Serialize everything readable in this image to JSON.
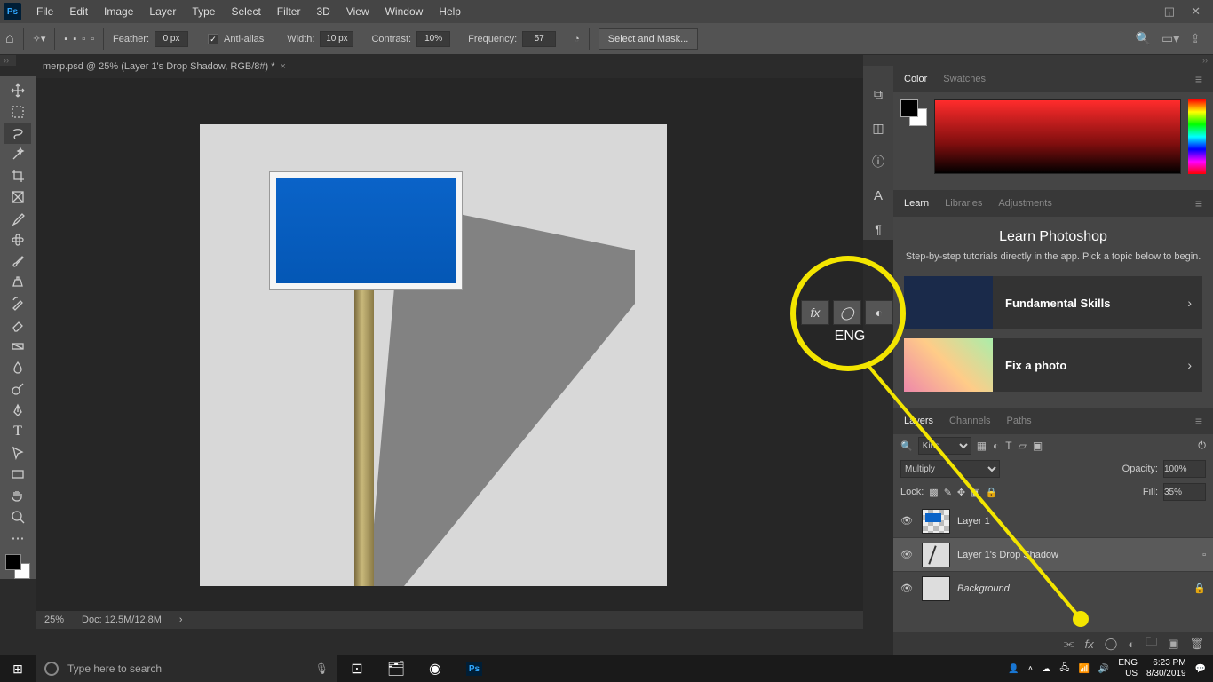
{
  "menubar": {
    "items": [
      "File",
      "Edit",
      "Image",
      "Layer",
      "Type",
      "Select",
      "Filter",
      "3D",
      "View",
      "Window",
      "Help"
    ]
  },
  "optbar": {
    "feather_label": "Feather:",
    "feather_val": "0 px",
    "aa_label": "Anti-alias",
    "width_label": "Width:",
    "width_val": "10 px",
    "contrast_label": "Contrast:",
    "contrast_val": "10%",
    "freq_label": "Frequency:",
    "freq_val": "57",
    "mask_btn": "Select and Mask..."
  },
  "doc": {
    "tab": "merp.psd @ 25% (Layer 1's Drop Shadow, RGB/8#) *"
  },
  "status": {
    "zoom": "25%",
    "doc": "Doc: 12.5M/12.8M"
  },
  "panel_color": {
    "tabs": [
      "Color",
      "Swatches"
    ]
  },
  "panel_learn": {
    "tabs": [
      "Learn",
      "Libraries",
      "Adjustments"
    ],
    "title": "Learn Photoshop",
    "subtitle": "Step-by-step tutorials directly in the app. Pick a topic below to begin.",
    "cards": [
      {
        "label": "Fundamental Skills"
      },
      {
        "label": "Fix a photo"
      }
    ]
  },
  "panel_layers": {
    "tabs": [
      "Layers",
      "Channels",
      "Paths"
    ],
    "kind": "Kind",
    "blend": "Multiply",
    "opacity_label": "Opacity:",
    "opacity": "100%",
    "lock_label": "Lock:",
    "fill_label": "Fill:",
    "fill": "35%",
    "layers": [
      {
        "name": "Layer 1"
      },
      {
        "name": "Layer 1's Drop Shadow"
      },
      {
        "name": "Background"
      }
    ]
  },
  "magnifier": {
    "lang": "ENG"
  },
  "taskbar": {
    "search_placeholder": "Type here to search",
    "lang1": "ENG",
    "lang2": "US",
    "time": "6:23 PM",
    "date": "8/30/2019"
  }
}
